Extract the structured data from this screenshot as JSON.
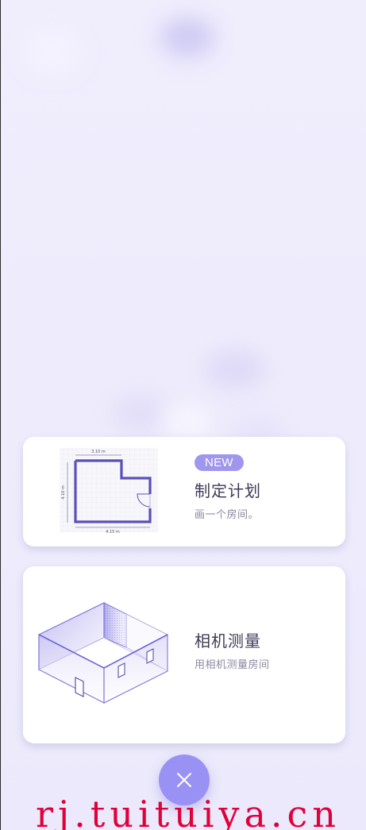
{
  "cards": [
    {
      "id": "plan",
      "badge": "NEW",
      "title": "制定计划",
      "subtitle": "画一个房间。",
      "illustration": "floor-plan-illustration"
    },
    {
      "id": "camera",
      "title": "相机测量",
      "subtitle": "用相机测量房间",
      "illustration": "3d-room-illustration"
    }
  ],
  "floor_plan": {
    "dim_top": "3.10 m",
    "dim_left": "4.10 m",
    "dim_bottom": "4.15 m"
  },
  "close_button": {
    "icon": "close-icon"
  },
  "watermark": "rj.tuituiya.cn",
  "colors": {
    "accent": "#9a91f4",
    "badge": "#9f96ee",
    "plan_wall": "#5b50b8",
    "background": "#efedfc",
    "watermark": "#e0003a"
  }
}
